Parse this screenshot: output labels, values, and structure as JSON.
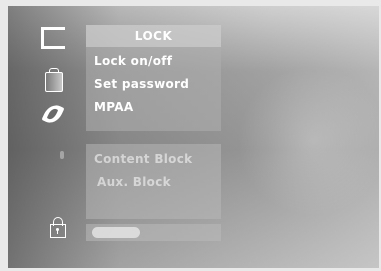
{
  "menu": {
    "title": "LOCK",
    "items": [
      "Lock on/off",
      "Set password",
      "MPAA"
    ]
  },
  "submenu": {
    "items": [
      "Content Block",
      "Aux. Block"
    ]
  },
  "sidebar": {
    "icons": [
      "screen-icon",
      "audio-icon",
      "picture-icon",
      "setup-icon",
      "lock-icon"
    ]
  }
}
